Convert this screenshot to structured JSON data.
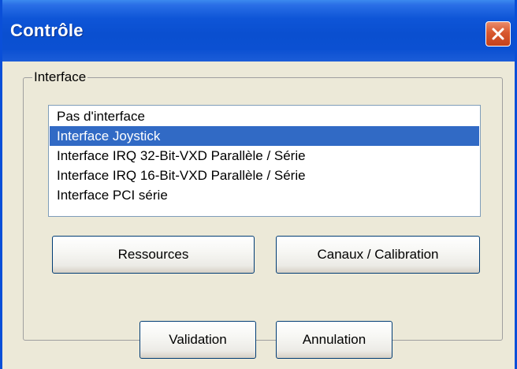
{
  "window": {
    "title": "Contrôle",
    "close_icon": "close-icon",
    "accent_color": "#0a4fd0",
    "close_color": "#d8582f"
  },
  "interface_group": {
    "label": "Interface",
    "options": [
      "Pas d'interface",
      "Interface Joystick",
      "Interface IRQ 32-Bit-VXD Parallèle / Série",
      "Interface IRQ 16-Bit-VXD Parallèle / Série",
      "Interface PCI série"
    ],
    "selected": "Interface Joystick",
    "selection_color": "#316ac5"
  },
  "buttons": {
    "resources": "Ressources",
    "channels": "Canaux / Calibration",
    "validate": "Validation",
    "cancel": "Annulation"
  }
}
